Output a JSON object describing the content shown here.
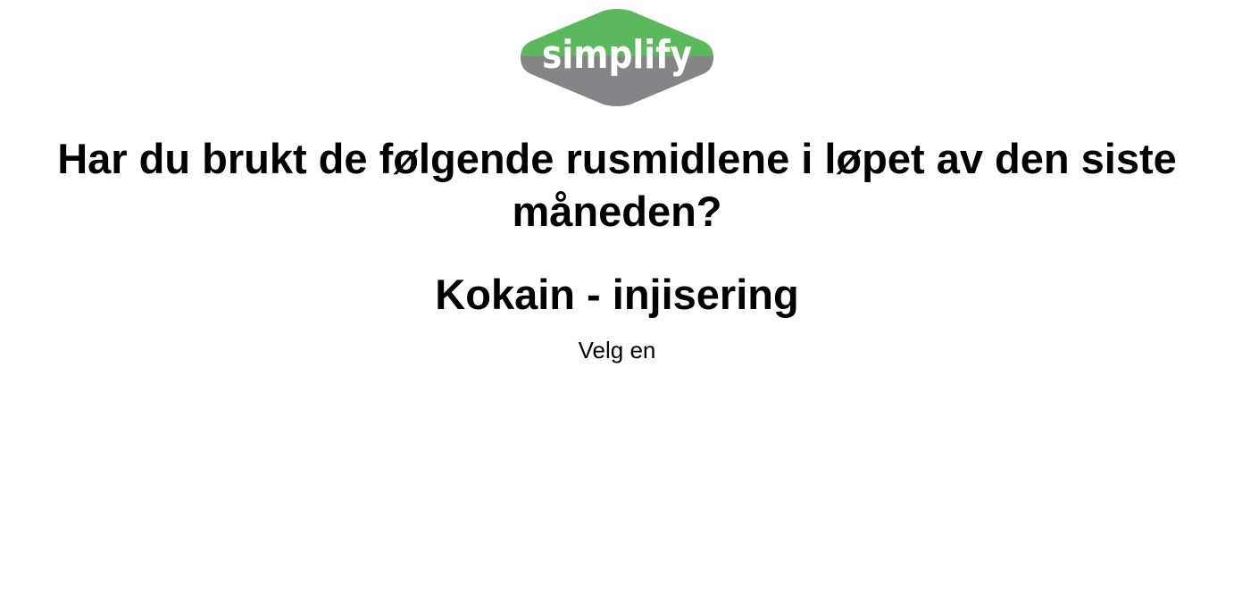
{
  "brand": {
    "logo_text": "simplify",
    "colors": {
      "green": "#5cb85c",
      "gray": "#858587",
      "text": "#ffffff"
    }
  },
  "survey": {
    "question": "Har du brukt de følgende rusmidlene i løpet av den siste måneden?",
    "substance": "Kokain - injisering",
    "instruction": "Velg en"
  }
}
